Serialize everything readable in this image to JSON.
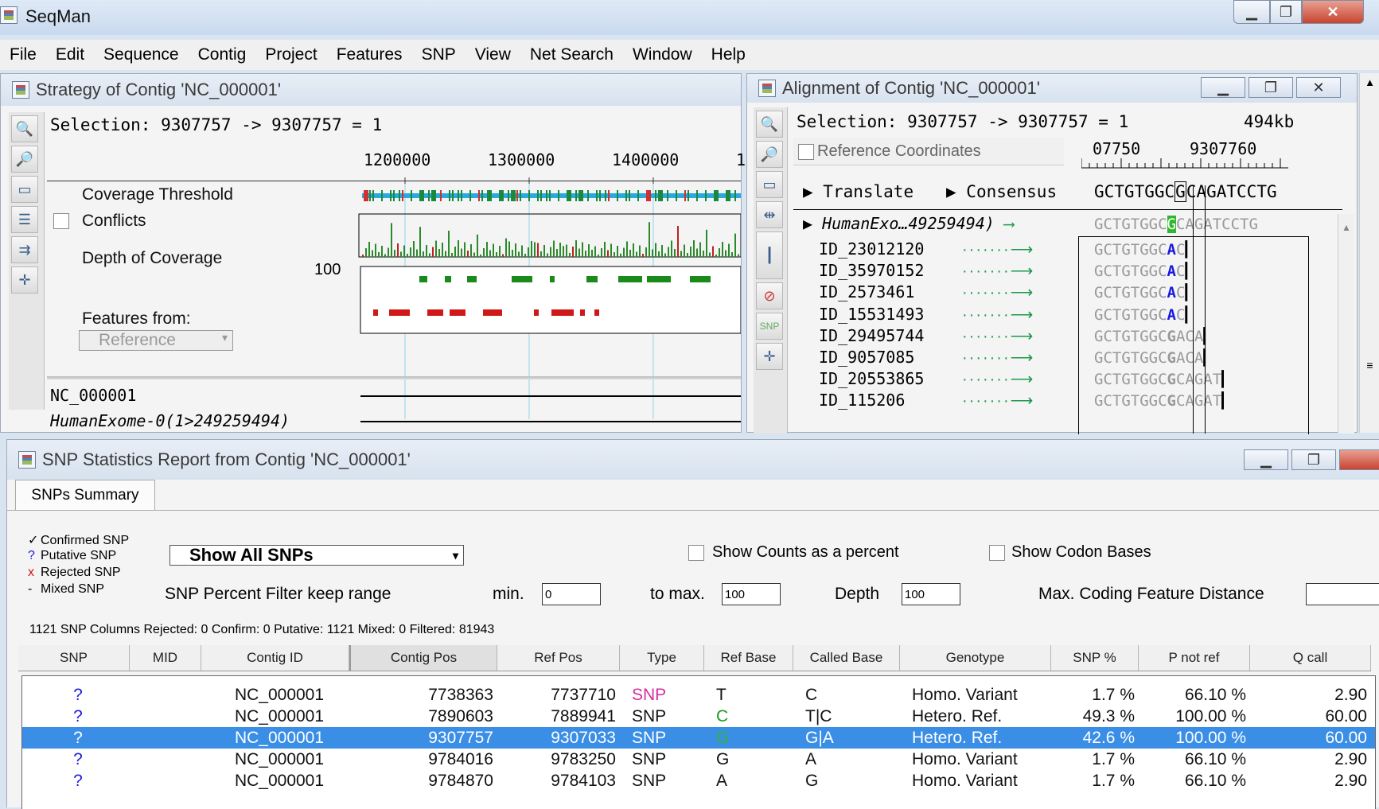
{
  "app": {
    "title": "SeqMan"
  },
  "menu": [
    "File",
    "Edit",
    "Sequence",
    "Contig",
    "Project",
    "Features",
    "SNP",
    "View",
    "Net Search",
    "Window",
    "Help"
  ],
  "strategy": {
    "title": "Strategy of Contig 'NC_000001'",
    "selection": "Selection: 9307757 -> 9307757 = 1",
    "ruler": [
      "1200000",
      "1300000",
      "1400000",
      "1"
    ],
    "coverage_threshold_label": "Coverage Threshold",
    "conflicts_label": "Conflicts",
    "depth_label": "Depth of Coverage",
    "depth_value": "100",
    "features_label": "Features from:",
    "features_select": "Reference",
    "seq1": "NC_000001",
    "seq2": "HumanExome-0(1>249259494)"
  },
  "alignment": {
    "title": "Alignment of Contig 'NC_000001'",
    "selection": "Selection: 9307757 -> 9307757 = 1",
    "size": "494kb",
    "ref_coords_label": "Reference Coordinates",
    "ruler": [
      "07750",
      "9307760"
    ],
    "translate_label": "Translate",
    "consensus_label": "Consensus",
    "consensus_seq_left": "GCTGTGGC",
    "consensus_seq_mid": "G",
    "consensus_seq_right": "CAGATCCTG",
    "ref_row": {
      "name": "HumanExo…49259494)",
      "left": "GCTGTGGC",
      "mid": "G",
      "right": "CAGATCCTG"
    },
    "reads": [
      {
        "id": "ID_23012120",
        "left": "GCTGTGGC",
        "mid": "A",
        "right": "C"
      },
      {
        "id": "ID_35970152",
        "left": "GCTGTGGC",
        "mid": "A",
        "right": "C"
      },
      {
        "id": "ID_2573461",
        "left": "GCTGTGGC",
        "mid": "A",
        "right": "C"
      },
      {
        "id": "ID_15531493",
        "left": "GCTGTGGC",
        "mid": "A",
        "right": "C"
      },
      {
        "id": "ID_29495744",
        "left": "GCTGTGGC",
        "mid": "G",
        "right": "ACA"
      },
      {
        "id": "ID_9057085",
        "left": "GCTGTGGC",
        "mid": "G",
        "right": "ACA"
      },
      {
        "id": "ID_20553865",
        "left": "GCTGTGGC",
        "mid": "G",
        "right": "CAGAT"
      },
      {
        "id": "ID_115206",
        "left": "GCTGTGGC",
        "mid": "G",
        "right": "CAGAT"
      }
    ]
  },
  "snp_report": {
    "title": "SNP Statistics Report from Contig 'NC_000001'",
    "tab": "SNPs Summary",
    "legend": [
      {
        "sym": "✓",
        "label": "Confirmed SNP",
        "color": "#000000"
      },
      {
        "sym": "?",
        "label": "Putative SNP",
        "color": "#1a1adf"
      },
      {
        "sym": "x",
        "label": "Rejected SNP",
        "color": "#d01010"
      },
      {
        "sym": "-",
        "label": "Mixed SNP",
        "color": "#000000"
      }
    ],
    "show_select": "Show All SNPs",
    "show_counts_label": "Show Counts as a percent",
    "show_codon_label": "Show Codon Bases",
    "filter_label": "SNP Percent Filter  keep range",
    "min_label": "min.",
    "min_value": "0",
    "max_label": "to max.",
    "max_value": "100",
    "depth_label": "Depth",
    "depth_value": "100",
    "coding_label": "Max. Coding Feature Distance",
    "stats": "1121 SNP Columns Rejected: 0 Confirm: 0 Putative: 1121 Mixed: 0 Filtered: 81943",
    "columns": [
      "SNP",
      "MID",
      "Contig ID",
      "Contig Pos",
      "Ref Pos",
      "Type",
      "Ref Base",
      "Called Base",
      "Genotype",
      "SNP %",
      "P not ref",
      "Q call"
    ],
    "rows": [
      {
        "snp": "?",
        "mid": "",
        "contig": "NC_000001",
        "cpos": "7738363",
        "rpos": "7737710",
        "type": "SNP",
        "refb": "T",
        "called": "C",
        "geno": "Homo. Variant",
        "pct": "1.7 %",
        "pnot": "66.10 %",
        "q": "2.90",
        "selected": false,
        "type_color": "#d22fa0",
        "ref_color": "#111111"
      },
      {
        "snp": "?",
        "mid": "",
        "contig": "NC_000001",
        "cpos": "7890603",
        "rpos": "7889941",
        "type": "SNP",
        "refb": "C",
        "called": "T|C",
        "geno": "Hetero. Ref.",
        "pct": "49.3 %",
        "pnot": "100.00 %",
        "q": "60.00",
        "selected": false,
        "type_color": "#111111",
        "ref_color": "#1f9a1f"
      },
      {
        "snp": "?",
        "mid": "",
        "contig": "NC_000001",
        "cpos": "9307757",
        "rpos": "9307033",
        "type": "SNP",
        "refb": "G",
        "called": "G|A",
        "geno": "Hetero. Ref.",
        "pct": "42.6 %",
        "pnot": "100.00 %",
        "q": "60.00",
        "selected": true,
        "type_color": "#ffffff",
        "ref_color": "#2db82d"
      },
      {
        "snp": "?",
        "mid": "",
        "contig": "NC_000001",
        "cpos": "9784016",
        "rpos": "9783250",
        "type": "SNP",
        "refb": "G",
        "called": "A",
        "geno": "Homo. Variant",
        "pct": "1.7 %",
        "pnot": "66.10 %",
        "q": "2.90",
        "selected": false,
        "type_color": "#111111",
        "ref_color": "#111111"
      },
      {
        "snp": "?",
        "mid": "",
        "contig": "NC_000001",
        "cpos": "9784870",
        "rpos": "9784103",
        "type": "SNP",
        "refb": "A",
        "called": "G",
        "geno": "Homo. Variant",
        "pct": "1.7 %",
        "pnot": "66.10 %",
        "q": "2.90",
        "selected": false,
        "type_color": "#111111",
        "ref_color": "#111111"
      }
    ]
  }
}
